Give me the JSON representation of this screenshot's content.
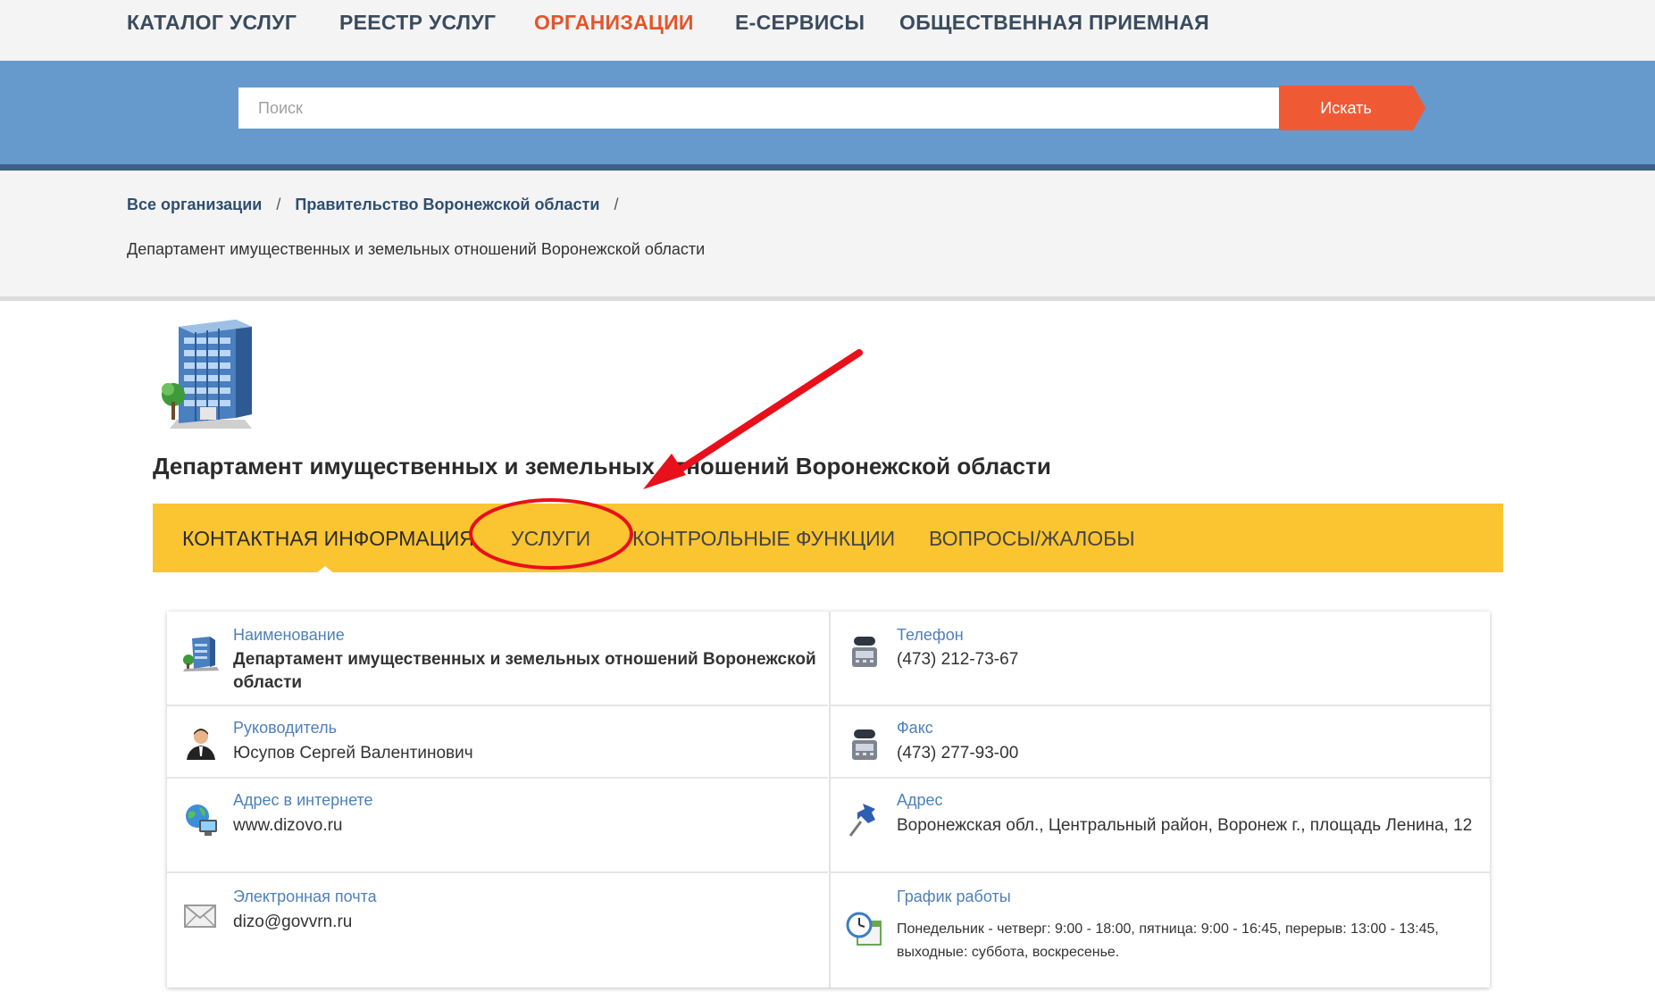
{
  "topnav": {
    "items": [
      {
        "label": "КАТАЛОГ УСЛУГ",
        "active": false
      },
      {
        "label": "РЕЕСТР УСЛУГ",
        "active": false
      },
      {
        "label": "ОРГАНИЗАЦИИ",
        "active": true
      },
      {
        "label": "Е-СЕРВИСЫ",
        "active": false
      },
      {
        "label": "ОБЩЕСТВЕННАЯ ПРИЕМНАЯ",
        "active": false
      }
    ]
  },
  "search": {
    "placeholder": "Поиск",
    "value": "",
    "button_label": "Искать"
  },
  "breadcrumb": {
    "items": [
      "Все организации",
      "Правительство Воронежской области"
    ],
    "separator": "/",
    "current": "Департамент имущественных и земельных отношений Воронежской области"
  },
  "org": {
    "icon": "office-building-icon",
    "title": "Департамент имущественных и земельных отношений Воронежской области"
  },
  "tabs": [
    {
      "label": "КОНТАКТНАЯ ИНФОРМАЦИЯ",
      "active": true
    },
    {
      "label": "УСЛУГИ",
      "active": false
    },
    {
      "label": "КОНТРОЛЬНЫЕ ФУНКЦИИ",
      "active": false
    },
    {
      "label": "ВОПРОСЫ/ЖАЛОБЫ",
      "active": false
    }
  ],
  "contacts": {
    "name": {
      "label": "Наименование",
      "value": "Департамент имущественных и земельных отношений Воронежской области",
      "icon": "building-icon"
    },
    "head": {
      "label": "Руководитель",
      "value": "Юсупов Сергей Валентинович",
      "icon": "person-icon"
    },
    "website": {
      "label": "Адрес в интернете",
      "value": "www.dizovo.ru",
      "icon": "globe-computer-icon"
    },
    "email": {
      "label": "Электронная почта",
      "value": "dizo@govvrn.ru",
      "icon": "envelope-icon"
    },
    "phone": {
      "label": "Телефон",
      "value": "(473) 212-73-67",
      "icon": "phone-icon"
    },
    "fax": {
      "label": "Факс",
      "value": "(473) 277-93-00",
      "icon": "fax-icon"
    },
    "address": {
      "label": "Адрес",
      "value": "Воронежская обл., Центральный район, Воронеж г., площадь Ленина, 12",
      "icon": "pushpin-icon"
    },
    "schedule": {
      "label": "График работы",
      "value": "Понедельник - четверг: 9:00 - 18:00, пятница: 9:00 - 16:45, перерыв: 13:00 - 13:45, выходные: суббота, воскресенье.",
      "icon": "clock-calendar-icon"
    }
  },
  "colors": {
    "nav_active": "#e5542b",
    "search_band": "#6699cc",
    "search_button": "#ef5a35",
    "tabs_bar": "#fbc531",
    "label_blue": "#4f80b8",
    "annotation_red": "#e8101a"
  },
  "annotation": {
    "arrow_icon": "red-arrow-annotation",
    "circle_icon": "red-ellipse-annotation"
  }
}
